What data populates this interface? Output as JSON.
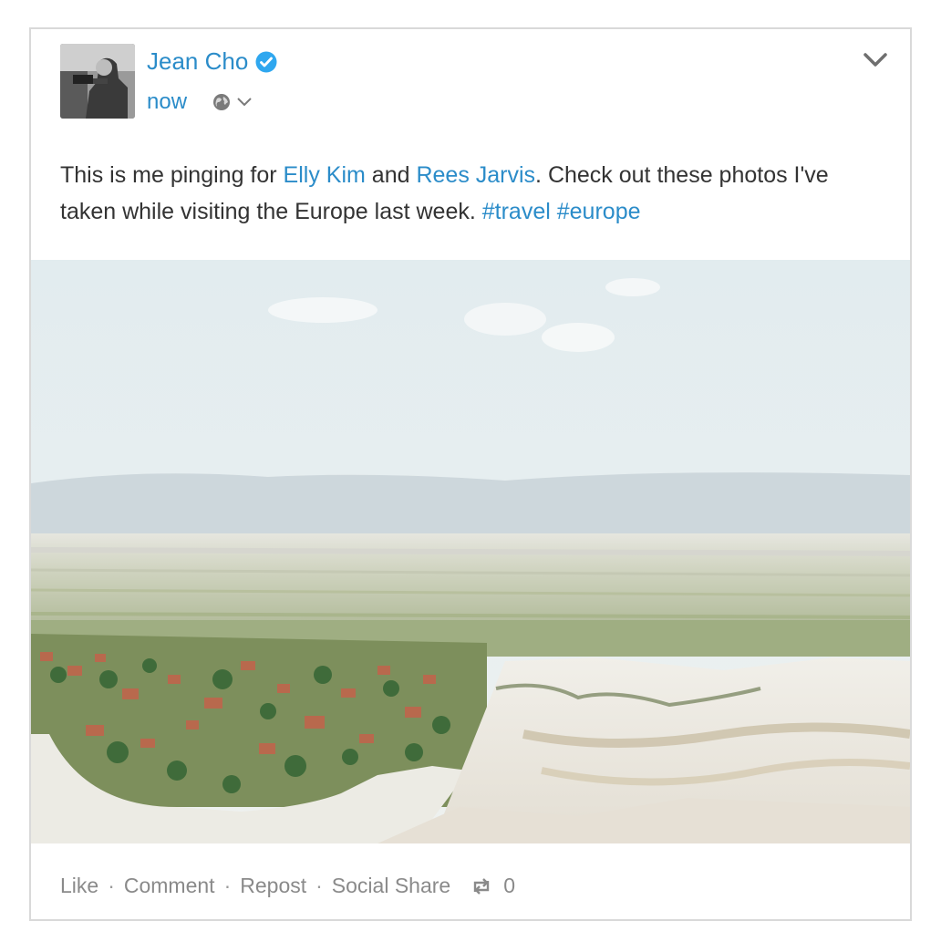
{
  "post": {
    "author": "Jean Cho",
    "time": "now",
    "text_parts": {
      "p1": "This is me pinging for ",
      "mention1": "Elly Kim",
      "p2": " and ",
      "mention2": "Rees Jarvis",
      "p3": ". Check out these photos I've taken while visiting the Europe last week. ",
      "tag1": "#travel",
      "p4": " ",
      "tag2": "#europe"
    }
  },
  "actions": {
    "like": "Like",
    "comment": "Comment",
    "repost": "Repost",
    "social_share": "Social Share",
    "separator": "·",
    "repost_count": "0"
  },
  "icons": {
    "verified": "verified-check-icon",
    "globe": "globe-icon",
    "chevron": "chevron-down-icon",
    "repost": "repost-icon"
  },
  "colors": {
    "link": "#2b8cc9",
    "verified": "#2fa7ef",
    "text": "#333333",
    "muted": "#8a8a8a",
    "border": "#d9d9d9"
  }
}
